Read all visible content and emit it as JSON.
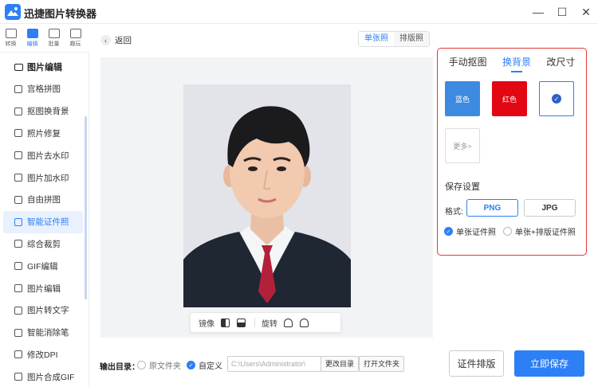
{
  "app": {
    "title": "迅捷图片转换器"
  },
  "window": {
    "menu_icon": "hamburger-icon",
    "minimize": "—",
    "maximize": "☐",
    "close": "✕"
  },
  "top_tabs": [
    {
      "label": "转换",
      "icon": "convert-icon"
    },
    {
      "label": "编辑",
      "icon": "edit-icon",
      "active": true
    },
    {
      "label": "批量",
      "icon": "batch-icon"
    },
    {
      "label": "趣玩",
      "icon": "fun-icon"
    }
  ],
  "sidebar": {
    "heading": "图片编辑",
    "items": [
      {
        "label": "宫格拼图"
      },
      {
        "label": "抠图换背景"
      },
      {
        "label": "照片修复"
      },
      {
        "label": "图片去水印"
      },
      {
        "label": "图片加水印"
      },
      {
        "label": "自由拼图"
      },
      {
        "label": "智能证件照",
        "active": true
      },
      {
        "label": "综合裁剪"
      },
      {
        "label": "GIF编辑"
      },
      {
        "label": "图片编辑"
      },
      {
        "label": "图片转文字"
      },
      {
        "label": "智能消除笔"
      },
      {
        "label": "修改DPI"
      },
      {
        "label": "图片合成GIF"
      }
    ]
  },
  "main": {
    "back_label": "返回",
    "mode_tabs": [
      {
        "label": "单张照",
        "active": true
      },
      {
        "label": "排版照"
      }
    ]
  },
  "toolbar": {
    "mirror_label": "镜像",
    "rotate_label": "旋转"
  },
  "output": {
    "label": "输出目录：",
    "option_original": "原文件夹",
    "option_custom": "自定义",
    "path": "C:\\Users\\Administrator\\",
    "change_dir": "更改目录",
    "open_folder": "打开文件夹"
  },
  "panel": {
    "tabs": [
      {
        "label": "手动抠图"
      },
      {
        "label": "换背景",
        "active": true
      },
      {
        "label": "改尺寸"
      }
    ],
    "colors": [
      {
        "label": "蓝色",
        "hex": "#3d8be0"
      },
      {
        "label": "红色",
        "hex": "#e30613"
      },
      {
        "label": "",
        "hex": "#ffffff",
        "selected": true
      }
    ],
    "more_label": "更多>",
    "save_settings": "保存设置",
    "format_label": "格式:",
    "formats": [
      {
        "label": "PNG",
        "active": true
      },
      {
        "label": "JPG"
      }
    ],
    "modes": [
      {
        "label": "单张证件照",
        "checked": true
      },
      {
        "label": "单张+排版证件照"
      }
    ]
  },
  "actions": {
    "layout_button": "证件排版",
    "save_button": "立即保存"
  },
  "colors": {
    "accent": "#2d7ff5",
    "highlight_border": "#e53935"
  }
}
